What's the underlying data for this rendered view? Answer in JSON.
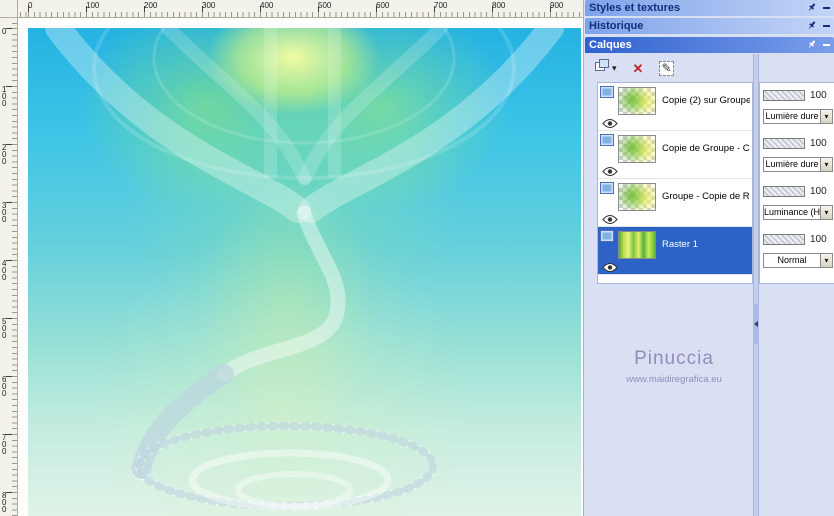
{
  "rulers": {
    "h_labels": [
      "0",
      "100",
      "200",
      "300",
      "400",
      "500",
      "600",
      "700",
      "800",
      "900"
    ],
    "v_labels": [
      "0",
      "1\n0\n0",
      "2\n0\n0",
      "3\n0\n0",
      "4\n0\n0",
      "5\n0\n0",
      "6\n0\n0",
      "7\n0\n0",
      "8\n0\n0"
    ]
  },
  "panels": {
    "styles": {
      "title": "Styles et textures"
    },
    "history": {
      "title": "Historique"
    },
    "layers": {
      "title": "Calques",
      "rows": [
        {
          "name": "Copie (2) sur Groupe",
          "opacity": "100",
          "blend": "Lumière dure"
        },
        {
          "name": "Copie de Groupe - Co",
          "opacity": "100",
          "blend": "Lumière dure"
        },
        {
          "name": "Groupe - Copie de Ra",
          "opacity": "100",
          "blend": "Luminance (H)"
        },
        {
          "name": "Raster 1",
          "opacity": "100",
          "blend": "Normal"
        }
      ],
      "watermark": {
        "line1": "Pinuccia",
        "line2": "www.maidiregrafica.eu"
      }
    }
  },
  "ui": {
    "dropdown_arrow": "▾",
    "delete_glyph": "✕",
    "edit_glyph": "✎"
  },
  "colors": {
    "selection": "#2e63c6",
    "titlebar_active": "#2f62cf",
    "panel_bg": "#d9e0f4",
    "canvas_cyan": "#25b2e2",
    "watermark": "#958cb9"
  }
}
